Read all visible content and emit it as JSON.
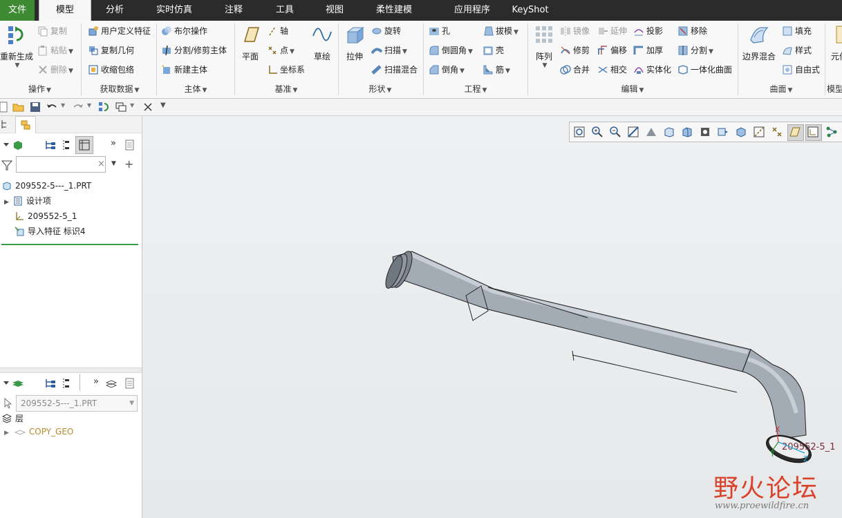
{
  "menu": {
    "tabs": [
      "文件",
      "模型",
      "分析",
      "实时仿真",
      "注释",
      "工具",
      "视图",
      "柔性建模",
      "应用程序",
      "KeyShot"
    ],
    "active": "模型"
  },
  "ribbon": {
    "operations": {
      "regenerate": "重新生成",
      "copy": "复制",
      "paste": "粘贴",
      "delete": "删除",
      "label": "操作"
    },
    "get_data": {
      "udf": "用户定义特征",
      "copy_geom": "复制几何",
      "shrinkwrap": "收缩包络",
      "label": "获取数据"
    },
    "body": {
      "boolean": "布尔操作",
      "split_trim": "分割/修剪主体",
      "new_body": "新建主体",
      "label": "主体"
    },
    "datum": {
      "plane": "平面",
      "axis": "轴",
      "point": "点",
      "csys": "坐标系",
      "sketch": "草绘",
      "label": "基准"
    },
    "shapes": {
      "extrude": "拉伸",
      "revolve": "旋转",
      "sweep": "扫描",
      "swept_blend": "扫描混合",
      "label": "形状"
    },
    "engineering": {
      "hole": "孔",
      "round": "倒圆角",
      "chamfer": "倒角",
      "draft": "拔模",
      "shell": "壳",
      "rib": "筋",
      "label": "工程"
    },
    "editing": {
      "pattern": "阵列",
      "mirror": "镜像",
      "extend": "延伸",
      "project": "投影",
      "remove": "移除",
      "trim": "修剪",
      "offset": "偏移",
      "thicken": "加厚",
      "split": "分割",
      "merge": "合并",
      "intersect": "相交",
      "solidify": "实体化",
      "unify": "一体化曲面",
      "label": "编辑"
    },
    "surfaces": {
      "boundary_blend": "边界混合",
      "fill": "填充",
      "style": "样式",
      "freestyle": "自由式",
      "label": "曲面"
    },
    "model_intent": {
      "label": "模型",
      "item": "元件"
    }
  },
  "model_tree": {
    "root": "209552-5---_1.PRT",
    "items": [
      "设计项",
      "209552-5_1",
      "导入特征 标识4"
    ],
    "search_value": ""
  },
  "layer_tree": {
    "selector": "209552-5---_1.PRT",
    "root": "层",
    "items": [
      "COPY_GEO"
    ]
  },
  "viewport": {
    "csys_label": "209552-5_1",
    "axis_x": "X",
    "axis_y": "Y",
    "axis_z": "Z"
  },
  "watermark": {
    "text": "野火论坛",
    "url": "www.proewildfire.cn"
  },
  "colors": {
    "menubar": "#2b2b2b",
    "file_tab": "#3d8a33",
    "pipe": "#a8b0ba",
    "viewport": "#eceef0"
  }
}
